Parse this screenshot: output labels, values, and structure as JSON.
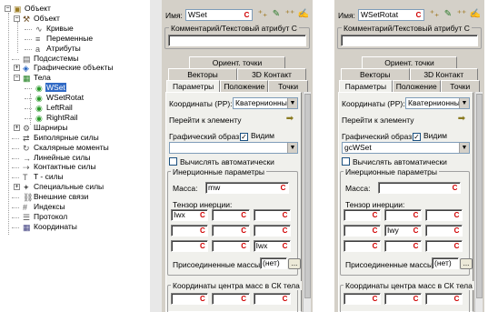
{
  "tree": {
    "nodes": [
      {
        "label": "Объект",
        "icon": "object-icon",
        "level": 0,
        "exp": "-"
      },
      {
        "label": "Объект",
        "icon": "hammer-icon",
        "level": 1,
        "exp": "-"
      },
      {
        "label": "Кривые",
        "icon": "curve-icon",
        "level": 2,
        "exp": ""
      },
      {
        "label": "Переменные",
        "icon": "variable-icon",
        "level": 2,
        "exp": ""
      },
      {
        "label": "Атрибуты",
        "icon": "attribute-icon",
        "level": 2,
        "exp": ""
      },
      {
        "label": "Подсистемы",
        "icon": "subsystem-icon",
        "level": 1,
        "exp": ""
      },
      {
        "label": "Графические объекты",
        "icon": "graphic-icon",
        "level": 1,
        "exp": "+"
      },
      {
        "label": "Тела",
        "icon": "body-icon",
        "level": 1,
        "exp": "-"
      },
      {
        "label": "WSet",
        "icon": "body-item-icon",
        "level": 2,
        "exp": "",
        "selected": true
      },
      {
        "label": "WSetRotat",
        "icon": "body-item-icon",
        "level": 2,
        "exp": ""
      },
      {
        "label": "LeftRail",
        "icon": "body-item-icon",
        "level": 2,
        "exp": ""
      },
      {
        "label": "RightRail",
        "icon": "body-item-icon",
        "level": 2,
        "exp": ""
      },
      {
        "label": "Шарниры",
        "icon": "joint-icon",
        "level": 1,
        "exp": "+"
      },
      {
        "label": "Биполярные силы",
        "icon": "bipolar-force-icon",
        "level": 1,
        "exp": ""
      },
      {
        "label": "Скалярные моменты",
        "icon": "scalar-torque-icon",
        "level": 1,
        "exp": ""
      },
      {
        "label": "Линейные силы",
        "icon": "linear-force-icon",
        "level": 1,
        "exp": ""
      },
      {
        "label": "Контактные силы",
        "icon": "contact-force-icon",
        "level": 1,
        "exp": ""
      },
      {
        "label": "T - силы",
        "icon": "t-force-icon",
        "level": 1,
        "exp": ""
      },
      {
        "label": "Специальные силы",
        "icon": "special-force-icon",
        "level": 1,
        "exp": "+"
      },
      {
        "label": "Внешние связи",
        "icon": "external-link-icon",
        "level": 1,
        "exp": ""
      },
      {
        "label": "Индексы",
        "icon": "index-icon",
        "level": 1,
        "exp": ""
      },
      {
        "label": "Протокол",
        "icon": "protocol-icon",
        "level": 1,
        "exp": ""
      },
      {
        "label": "Координаты",
        "icon": "coordinates-icon",
        "level": 1,
        "exp": ""
      }
    ]
  },
  "panel1": {
    "name_label": "Имя:",
    "name_value": "WSet",
    "comment_title": "Комментарий/Текстовый атрибут С",
    "tabs_row1": [
      "Ориент. точки"
    ],
    "tabs_row2": [
      "Векторы",
      "3D Контакт"
    ],
    "tabs_row3": [
      "Параметры",
      "Положение",
      "Точки"
    ],
    "coords_label": "Координаты (PP):",
    "coords_value": "Кватернионный",
    "goto_label": "Перейти к элементу",
    "graphic_label": "Графический образ:",
    "visible_label": "Видим",
    "graphic_value": "",
    "auto_label": "Вычислять автоматически",
    "inertia_title": "Инерционные параметры",
    "mass_label": "Масса:",
    "mass_value": "mw",
    "tensor_label": "Тензор инерции:",
    "tensor": [
      "Iwx",
      "",
      "",
      "",
      "",
      "",
      "",
      "",
      "Iwx"
    ],
    "attached_label": "Присоединенные массы:",
    "attached_value": "(нет)",
    "com_title": "Координаты центра масс в СК тела",
    "c_glyph": "C",
    "dots": "..."
  },
  "panel2": {
    "name_label": "Имя:",
    "name_value": "WSetRotat",
    "comment_title": "Комментарий/Текстовый атрибут С",
    "tabs_row1": [
      "Ориент. точки"
    ],
    "tabs_row2": [
      "Векторы",
      "3D Контакт"
    ],
    "tabs_row3": [
      "Параметры",
      "Положение",
      "Точки"
    ],
    "coords_label": "Координаты (PP):",
    "coords_value": "Кватернионный",
    "goto_label": "Перейти к элементу",
    "graphic_label": "Графический образ:",
    "visible_label": "Видим",
    "graphic_value": "gcWSet",
    "auto_label": "Вычислять автоматически",
    "inertia_title": "Инерционные параметры",
    "mass_label": "Масса:",
    "mass_value": "",
    "tensor_label": "Тензор инерции:",
    "tensor": [
      "",
      "",
      "",
      "",
      "Iwy",
      "",
      "",
      "",
      ""
    ],
    "attached_label": "Присоединенные массы:",
    "attached_value": "(нет)",
    "com_title": "Координаты центра масс в СК тела",
    "c_glyph": "C",
    "dots": "..."
  },
  "colors": {
    "selection": "#316ac5",
    "c_button": "#d00000",
    "panel": "#d4d0c8"
  }
}
